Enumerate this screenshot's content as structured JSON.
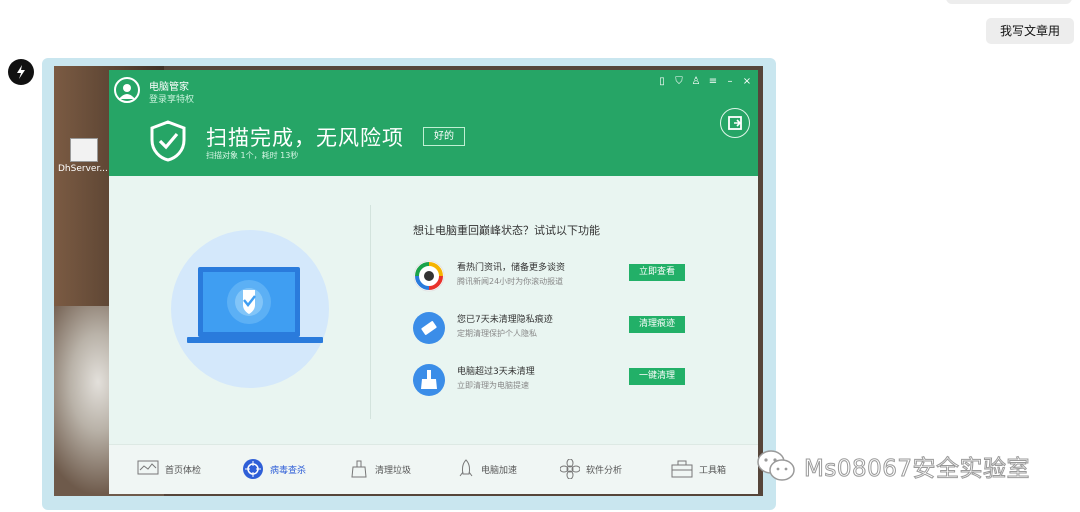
{
  "chat": {
    "message": "我写文章用"
  },
  "desktop": {
    "icon_label": "DhServer..."
  },
  "app": {
    "user": {
      "name": "电脑管家",
      "subtitle": "登录享特权"
    },
    "scan": {
      "title": "扫描完成，无风险项",
      "ok_label": "好的",
      "subtitle": "扫描对象 1个，耗时 13秒"
    },
    "promo_title": "想让电脑重回巅峰状态？试试以下功能",
    "promos": [
      {
        "title": "看热门资讯，储备更多谈资",
        "sub": "腾讯新闻24小时为你滚动报道",
        "button": "立即查看",
        "icon": "news-icon"
      },
      {
        "title": "您已7天未清理隐私痕迹",
        "sub": "定期清理保护个人隐私",
        "button": "清理痕迹",
        "icon": "eraser-icon"
      },
      {
        "title": "电脑超过3天未清理",
        "sub": "立即清理为电脑提速",
        "button": "一键清理",
        "icon": "broom-icon"
      }
    ],
    "nav": [
      {
        "label": "首页体检",
        "icon": "home-check-icon"
      },
      {
        "label": "病毒查杀",
        "icon": "virus-scan-icon"
      },
      {
        "label": "清理垃圾",
        "icon": "clean-icon"
      },
      {
        "label": "电脑加速",
        "icon": "rocket-icon"
      },
      {
        "label": "软件分析",
        "icon": "software-icon"
      },
      {
        "label": "工具箱",
        "icon": "toolbox-icon"
      }
    ]
  },
  "watermark": {
    "text": "Ms08067安全实验室"
  },
  "colors": {
    "header_green": "#26a566",
    "button_green": "#22b068",
    "active_blue": "#2f5fd7"
  }
}
